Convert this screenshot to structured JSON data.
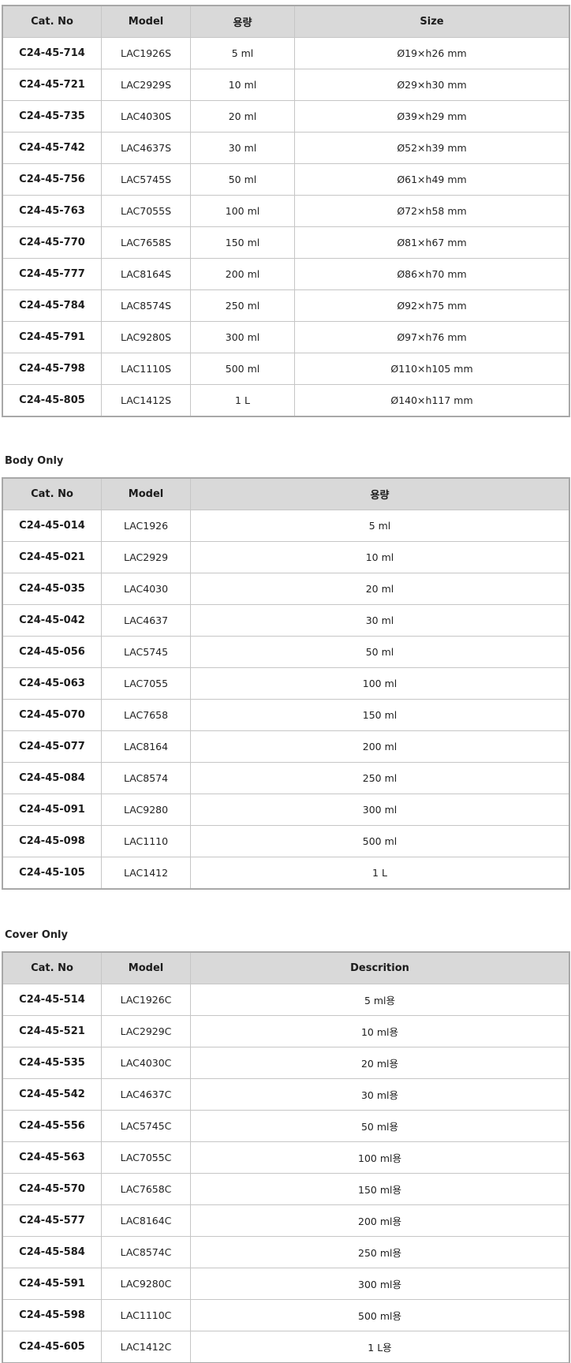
{
  "full_set": {
    "headers": [
      "Cat. No",
      "Model",
      "용량",
      "Size"
    ],
    "rows": [
      [
        "C24-45-714",
        "LAC1926S",
        "5 ml",
        "Ø19×h26 mm"
      ],
      [
        "C24-45-721",
        "LAC2929S",
        "10 ml",
        "Ø29×h30 mm"
      ],
      [
        "C24-45-735",
        "LAC4030S",
        "20 ml",
        "Ø39×h29 mm"
      ],
      [
        "C24-45-742",
        "LAC4637S",
        "30 ml",
        "Ø52×h39 mm"
      ],
      [
        "C24-45-756",
        "LAC5745S",
        "50 ml",
        "Ø61×h49 mm"
      ],
      [
        "C24-45-763",
        "LAC7055S",
        "100 ml",
        "Ø72×h58 mm"
      ],
      [
        "C24-45-770",
        "LAC7658S",
        "150 ml",
        "Ø81×h67 mm"
      ],
      [
        "C24-45-777",
        "LAC8164S",
        "200 ml",
        "Ø86×h70 mm"
      ],
      [
        "C24-45-784",
        "LAC8574S",
        "250 ml",
        "Ø92×h75 mm"
      ],
      [
        "C24-45-791",
        "LAC9280S",
        "300 ml",
        "Ø97×h76 mm"
      ],
      [
        "C24-45-798",
        "LAC1110S",
        "500 ml",
        "Ø110×h105 mm"
      ],
      [
        "C24-45-805",
        "LAC1412S",
        "1 L",
        "Ø140×h117 mm"
      ]
    ]
  },
  "body_only": {
    "title": "Body Only",
    "headers": [
      "Cat. No",
      "Model",
      "용량"
    ],
    "rows": [
      [
        "C24-45-014",
        "LAC1926",
        "5 ml"
      ],
      [
        "C24-45-021",
        "LAC2929",
        "10 ml"
      ],
      [
        "C24-45-035",
        "LAC4030",
        "20 ml"
      ],
      [
        "C24-45-042",
        "LAC4637",
        "30 ml"
      ],
      [
        "C24-45-056",
        "LAC5745",
        "50 ml"
      ],
      [
        "C24-45-063",
        "LAC7055",
        "100 ml"
      ],
      [
        "C24-45-070",
        "LAC7658",
        "150 ml"
      ],
      [
        "C24-45-077",
        "LAC8164",
        "200 ml"
      ],
      [
        "C24-45-084",
        "LAC8574",
        "250 ml"
      ],
      [
        "C24-45-091",
        "LAC9280",
        "300 ml"
      ],
      [
        "C24-45-098",
        "LAC1110",
        "500 ml"
      ],
      [
        "C24-45-105",
        "LAC1412",
        "1 L"
      ]
    ]
  },
  "cover_only": {
    "title": "Cover Only",
    "headers": [
      "Cat. No",
      "Model",
      "Descrition"
    ],
    "rows": [
      [
        "C24-45-514",
        "LAC1926C",
        "5 ml용"
      ],
      [
        "C24-45-521",
        "LAC2929C",
        "10 ml용"
      ],
      [
        "C24-45-535",
        "LAC4030C",
        "20 ml용"
      ],
      [
        "C24-45-542",
        "LAC4637C",
        "30 ml용"
      ],
      [
        "C24-45-556",
        "LAC5745C",
        "50 ml용"
      ],
      [
        "C24-45-563",
        "LAC7055C",
        "100 ml용"
      ],
      [
        "C24-45-570",
        "LAC7658C",
        "150 ml용"
      ],
      [
        "C24-45-577",
        "LAC8164C",
        "200 ml용"
      ],
      [
        "C24-45-584",
        "LAC8574C",
        "250 ml용"
      ],
      [
        "C24-45-591",
        "LAC9280C",
        "300 ml용"
      ],
      [
        "C24-45-598",
        "LAC1110C",
        "500 ml용"
      ],
      [
        "C24-45-605",
        "LAC1412C",
        "1 L용"
      ]
    ]
  }
}
